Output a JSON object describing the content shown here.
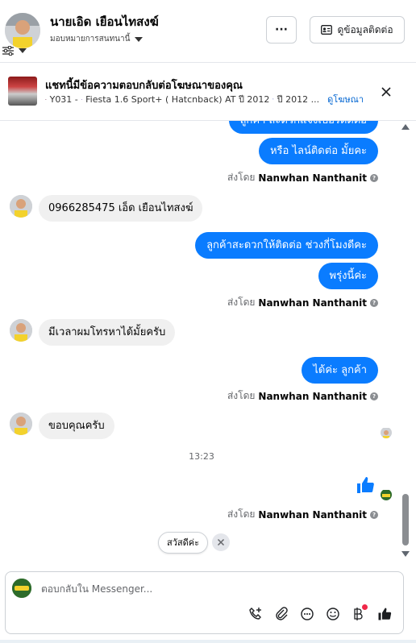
{
  "header": {
    "contact_name": "นายเอิด เยือนไทสงฆ์",
    "assign_label": "มอบหมายการสนทนานี้",
    "more_label": "···",
    "contact_info_label": "ดูข้อมูลติดต่อ"
  },
  "banner": {
    "title": "แชทนี้มีข้อความตอบกลับต่อโฆษณาของคุณ",
    "car_code": "Y031 -",
    "car_model": "Fiesta 1.6 Sport+ ( Hatcnback) AT ปี 2012",
    "year_tail": "ปี 2012 ...",
    "view_ad_label": "ดูโฆษณา"
  },
  "messages": {
    "m1": "ลูกค้า สะดวกแจ้งเบอร์ติดต่อ",
    "m2": "หรือ ไลน์ติดต่อ มั้ยคะ",
    "m3": "0966285475 เอ็ด เยือนไทสงฆ์",
    "m4": "ลูกค้าสะดวกให้ติดต่อ ช่วงกี่โมงดีคะ",
    "m5": "พรุ่งนี้ค่ะ",
    "m6": "มีเวลาผมโทรหาได้มั้ยครับ",
    "m7": "ได้ค่ะ  ลูกค้า",
    "m8": "ขอบคุณครับ",
    "timestamp": "13:23"
  },
  "sent_by": {
    "prefix": "ส่งโดย",
    "name": "Nanwhan Nanthanit",
    "info_mark": "?"
  },
  "quick_reply": {
    "chip": "สวัสดีค่ะ"
  },
  "composer": {
    "placeholder": "ตอบกลับใน Messenger..."
  },
  "colors": {
    "outgoing_bubble": "#0a7cff",
    "incoming_bubble": "#f0f0f0",
    "link": "#0064d1",
    "notification_dot": "#f02849"
  },
  "icons": [
    "filter-icon",
    "more-icon",
    "contact-card-icon",
    "close-icon",
    "car-icon",
    "calendar-icon",
    "help-icon",
    "thumbs-up-icon",
    "call-add-icon",
    "attachment-icon",
    "chat-bubble-icon",
    "emoji-icon",
    "baht-icon",
    "scroll-up-icon",
    "scroll-down-icon"
  ]
}
